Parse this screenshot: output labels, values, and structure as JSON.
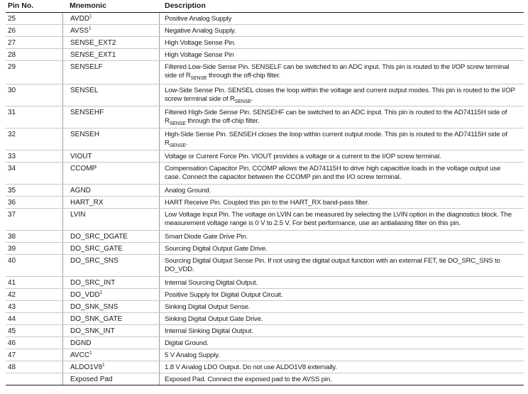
{
  "headers": {
    "pin_no": "Pin No.",
    "mnemonic": "Mnemonic",
    "description": "Description"
  },
  "rows": [
    {
      "pin": "25",
      "mnemonic": "AVDD",
      "sup": "1",
      "desc": [
        "Positive Analog Supply"
      ]
    },
    {
      "pin": "26",
      "mnemonic": "AVSS",
      "sup": "1",
      "desc": [
        "Negative Analog Supply."
      ]
    },
    {
      "pin": "27",
      "mnemonic": "SENSE_EXT2",
      "desc": [
        "High Voltage Sense Pin."
      ]
    },
    {
      "pin": "28",
      "mnemonic": "SENSE_EXT1",
      "desc": [
        "High Voltage Sense Pin"
      ]
    },
    {
      "pin": "29",
      "mnemonic": "SENSELF",
      "desc": [
        "Filtered Low-Side Sense Pin. SENSELF can be switched to an ADC input. This pin is routed to the I/OP screw terminal",
        "side of R",
        "SENSE",
        " through the off-chip filter."
      ]
    },
    {
      "pin": "30",
      "mnemonic": "SENSEL",
      "desc": [
        "Low-Side Sense Pin. SENSEL closes the loop within the voltage and current output modes. This pin is routed to the I/OP",
        "screw terminal side of R",
        "SENSE",
        "."
      ]
    },
    {
      "pin": "31",
      "mnemonic": "SENSEHF",
      "desc": [
        "Filtered High-Side Sense Pin. SENSEHF can be switched to an ADC input. This pin is routed to the AD74115H side of",
        "R",
        "SENSE",
        " through the off-chip filter."
      ]
    },
    {
      "pin": "32",
      "mnemonic": "SENSEH",
      "desc": [
        "High-Side Sense Pin. SENSEH closes the loop within current output mode. This pin is routed to the AD74115H side of",
        "R",
        "SENSE",
        "."
      ]
    },
    {
      "pin": "33",
      "mnemonic": "VIOUT",
      "desc": [
        "Voltage or Current Force Pin. VIOUT provides a voltage or a current to the I/OP screw terminal."
      ]
    },
    {
      "pin": "34",
      "mnemonic": "CCOMP",
      "desc": [
        "Compensation Capacitor Pin. CCOMP allows the AD74115H to drive high capacitive loads in the voltage output use",
        "case. Connect the capacitor between the CCOMP pin and the I/O screw terminal."
      ]
    },
    {
      "pin": "35",
      "mnemonic": "AGND",
      "desc": [
        "Analog Ground."
      ]
    },
    {
      "pin": "36",
      "mnemonic": "HART_RX",
      "desc": [
        "HART Receive Pin. Coupled this pin to the HART_RX band-pass filter."
      ]
    },
    {
      "pin": "37",
      "mnemonic": "LVIN",
      "desc": [
        "Low Voltage Input Pin. The voltage on LVIN can be measured by selecting the LVIN option in the diagnostics block. The",
        "measurement voltage range is 0 V to 2.5 V. For best performance, use an antialiasing filter on this pin."
      ]
    },
    {
      "pin": "38",
      "mnemonic": "DO_SRC_DGATE",
      "desc": [
        "Smart Diode Gate Drive Pin."
      ]
    },
    {
      "pin": "39",
      "mnemonic": "DO_SRC_GATE",
      "desc": [
        "Sourcing Digital Output Gate Drive."
      ]
    },
    {
      "pin": "40",
      "mnemonic": "DO_SRC_SNS",
      "desc": [
        "Sourcing Digital Output Sense Pin. If not using the digital output function with an external FET, tie DO_SRC_SNS to",
        "DO_VDD."
      ]
    },
    {
      "pin": "41",
      "mnemonic": "DO_SRC_INT",
      "desc": [
        "Internal Sourcing Digital Output."
      ]
    },
    {
      "pin": "42",
      "mnemonic": "DO_VDD",
      "sup": "1",
      "desc": [
        "Positive Supply for Digital Output Circuit."
      ]
    },
    {
      "pin": "43",
      "mnemonic": "DO_SNK_SNS",
      "desc": [
        "Sinking Digital Output Sense."
      ]
    },
    {
      "pin": "44",
      "mnemonic": "DO_SNK_GATE",
      "desc": [
        "Sinking Digital Output Gate Drive."
      ]
    },
    {
      "pin": "45",
      "mnemonic": "DO_SNK_INT",
      "desc": [
        "Internal Sinking Digital Output."
      ]
    },
    {
      "pin": "46",
      "mnemonic": "DGND",
      "desc": [
        "Digital Ground."
      ]
    },
    {
      "pin": "47",
      "mnemonic": "AVCC",
      "sup": "1",
      "desc": [
        "5 V Analog Supply."
      ]
    },
    {
      "pin": "48",
      "mnemonic": "ALDO1V8",
      "sup": "1",
      "desc": [
        "1.8 V Analog LDO Output. Do not use ALDO1V8 externally."
      ]
    },
    {
      "pin": "",
      "mnemonic": "Exposed Pad",
      "desc": [
        "Exposed Pad. Connect the exposed pad to the AVSS pin."
      ]
    }
  ]
}
